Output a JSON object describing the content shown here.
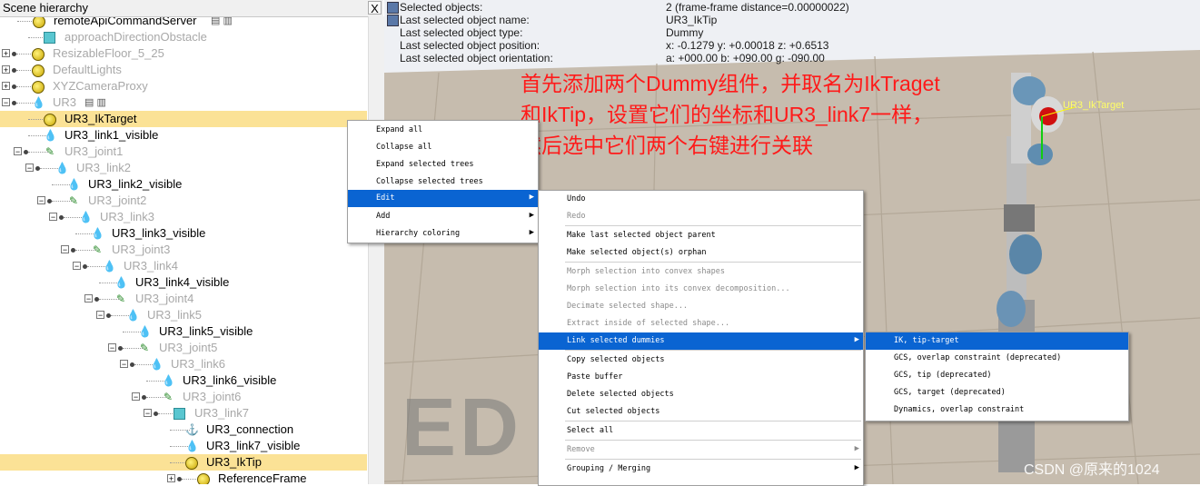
{
  "hierarchy": {
    "title": "Scene hierarchy",
    "close_glyph": "X",
    "rows": [
      {
        "label": "remoteApiCommandServer",
        "dim": false
      },
      {
        "label": "approachDirectionObstacle",
        "dim": true
      },
      {
        "label": "ResizableFloor_5_25",
        "dim": true
      },
      {
        "label": "DefaultLights",
        "dim": true
      },
      {
        "label": "XYZCameraProxy",
        "dim": true
      },
      {
        "label": "UR3",
        "dim": true
      },
      {
        "label": "UR3_IkTarget",
        "dim": false
      },
      {
        "label": "UR3_link1_visible",
        "dim": false
      },
      {
        "label": "UR3_joint1",
        "dim": true
      },
      {
        "label": "UR3_link2",
        "dim": true
      },
      {
        "label": "UR3_link2_visible",
        "dim": false
      },
      {
        "label": "UR3_joint2",
        "dim": true
      },
      {
        "label": "UR3_link3",
        "dim": true
      },
      {
        "label": "UR3_link3_visible",
        "dim": false
      },
      {
        "label": "UR3_joint3",
        "dim": true
      },
      {
        "label": "UR3_link4",
        "dim": true
      },
      {
        "label": "UR3_link4_visible",
        "dim": false
      },
      {
        "label": "UR3_joint4",
        "dim": true
      },
      {
        "label": "UR3_link5",
        "dim": true
      },
      {
        "label": "UR3_link5_visible",
        "dim": false
      },
      {
        "label": "UR3_joint5",
        "dim": true
      },
      {
        "label": "UR3_link6",
        "dim": true
      },
      {
        "label": "UR3_link6_visible",
        "dim": false
      },
      {
        "label": "UR3_joint6",
        "dim": true
      },
      {
        "label": "UR3_link7",
        "dim": true
      },
      {
        "label": "UR3_connection",
        "dim": false
      },
      {
        "label": "UR3_link7_visible",
        "dim": false
      },
      {
        "label": "UR3_IkTip",
        "dim": false
      },
      {
        "label": "ReferenceFrame",
        "dim": false
      }
    ]
  },
  "info": {
    "rows": [
      {
        "key": "Selected objects:",
        "value": "2 (frame-frame distance=0.00000022)"
      },
      {
        "key": "Last selected object name:",
        "value": "UR3_IkTip"
      },
      {
        "key": "Last selected object type:",
        "value": "Dummy"
      },
      {
        "key": "Last selected object position:",
        "value": "x: -0.1279    y: +0.00018    z: +0.6513"
      },
      {
        "key": "Last selected object orientation:",
        "value": "a: +000.00    b: +090.00    g: -090.00"
      }
    ]
  },
  "annotation": {
    "line1": "首先添加两个Dummy组件，并取名为IkTraget",
    "line2": "和IkTip，设置它们的坐标和UR3_link7一样，",
    "line3": "然后选中它们两个右键进行关联"
  },
  "viewport_labels": {
    "ik_target": "UR3_IkTarget",
    "watermark_ed": "ED",
    "csdn": "CSDN @原来的1024"
  },
  "menu1": {
    "items": [
      {
        "label": "Expand all"
      },
      {
        "label": "Collapse all"
      },
      {
        "label": "Expand selected trees"
      },
      {
        "label": "Collapse selected trees"
      },
      {
        "label": "Edit"
      },
      {
        "label": "Add"
      },
      {
        "label": "Hierarchy coloring"
      }
    ]
  },
  "menu2": {
    "items": [
      {
        "label": "Undo"
      },
      {
        "label": "Redo"
      },
      {
        "label": "Make last selected object parent"
      },
      {
        "label": "Make selected object(s) orphan"
      },
      {
        "label": "Morph selection into convex shapes"
      },
      {
        "label": "Morph selection into its convex decomposition..."
      },
      {
        "label": "Decimate selected shape..."
      },
      {
        "label": "Extract inside of selected shape..."
      },
      {
        "label": "Link selected dummies"
      },
      {
        "label": "Copy selected objects"
      },
      {
        "label": "Paste buffer"
      },
      {
        "label": "Delete selected objects"
      },
      {
        "label": "Cut selected objects"
      },
      {
        "label": "Select all"
      },
      {
        "label": "Remove"
      },
      {
        "label": "Grouping / Merging"
      }
    ]
  },
  "menu3": {
    "items": [
      {
        "label": "IK, tip-target"
      },
      {
        "label": "GCS, overlap constraint (deprecated)"
      },
      {
        "label": "GCS, tip (deprecated)"
      },
      {
        "label": "GCS, target (deprecated)"
      },
      {
        "label": "Dynamics, overlap constraint"
      }
    ]
  },
  "colors": {
    "selection_row": "#fbe296",
    "menu_highlight": "#0a64d2",
    "annotation": "#ff1a1a"
  }
}
